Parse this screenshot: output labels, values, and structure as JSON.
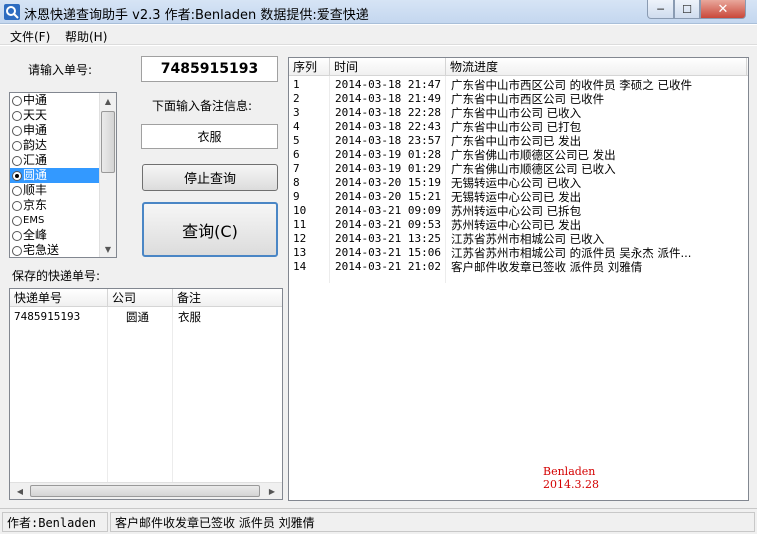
{
  "window": {
    "title": "沐恩快递查询助手 v2.3  作者:Benladen 数据提供:爱查快递",
    "min_label": "─",
    "max_label": "☐",
    "close_label": "✕"
  },
  "menu": {
    "file": "文件(F)",
    "help": "帮助(H)"
  },
  "form": {
    "tracking_label": "请输入单号:",
    "tracking_value": "7485915193",
    "note_label": "下面输入备注信息:",
    "note_value": "衣服",
    "stop_button": "停止查询",
    "query_button": "查询(C)",
    "saved_label": "保存的快递单号:"
  },
  "carriers": {
    "items": [
      "中通",
      "天天",
      "申通",
      "韵达",
      "汇通",
      "圆通",
      "顺丰",
      "京东",
      "EMS",
      "全峰",
      "宅急送"
    ],
    "selected": "圆通"
  },
  "saved_table": {
    "headers": [
      "快递单号",
      "公司",
      "备注"
    ],
    "rows": [
      [
        "7485915193",
        "圆通",
        "衣服"
      ]
    ]
  },
  "tracking_table": {
    "headers": [
      "序列",
      "时间",
      "物流进度"
    ],
    "rows": [
      [
        "1",
        "2014-03-18 21:47",
        "广东省中山市西区公司 的收件员 李硕之 已收件"
      ],
      [
        "2",
        "2014-03-18 21:49",
        "广东省中山市西区公司 已收件"
      ],
      [
        "3",
        "2014-03-18 22:28",
        "广东省中山市公司 已收入"
      ],
      [
        "4",
        "2014-03-18 22:43",
        "广东省中山市公司 已打包"
      ],
      [
        "5",
        "2014-03-18 23:57",
        "广东省中山市公司已 发出"
      ],
      [
        "6",
        "2014-03-19 01:28",
        "广东省佛山市顺德区公司已 发出"
      ],
      [
        "7",
        "2014-03-19 01:29",
        "广东省佛山市顺德区公司 已收入"
      ],
      [
        "8",
        "2014-03-20 15:19",
        "无锡转运中心公司 已收入"
      ],
      [
        "9",
        "2014-03-20 15:21",
        "无锡转运中心公司已 发出"
      ],
      [
        "10",
        "2014-03-21 09:09",
        "苏州转运中心公司 已拆包"
      ],
      [
        "11",
        "2014-03-21 09:53",
        "苏州转运中心公司已 发出"
      ],
      [
        "12",
        "2014-03-21 13:25",
        "江苏省苏州市相城公司 已收入"
      ],
      [
        "13",
        "2014-03-21 15:06",
        "江苏省苏州市相城公司 的派件员 吴永杰 派件..."
      ],
      [
        "14",
        "2014-03-21 21:02",
        "客户邮件收发章已签收 派件员 刘雅倩"
      ]
    ]
  },
  "signature": {
    "name": "Benladen",
    "date": "2014.3.28"
  },
  "status": {
    "author": "作者:Benladen",
    "message": "客户邮件收发章已签收 派件员 刘雅倩"
  },
  "colors": {
    "selection": "#3399ff",
    "signature": "#d40000",
    "titlebar": "#c4d7ef"
  },
  "icons": {
    "app": "magnifier-icon"
  }
}
